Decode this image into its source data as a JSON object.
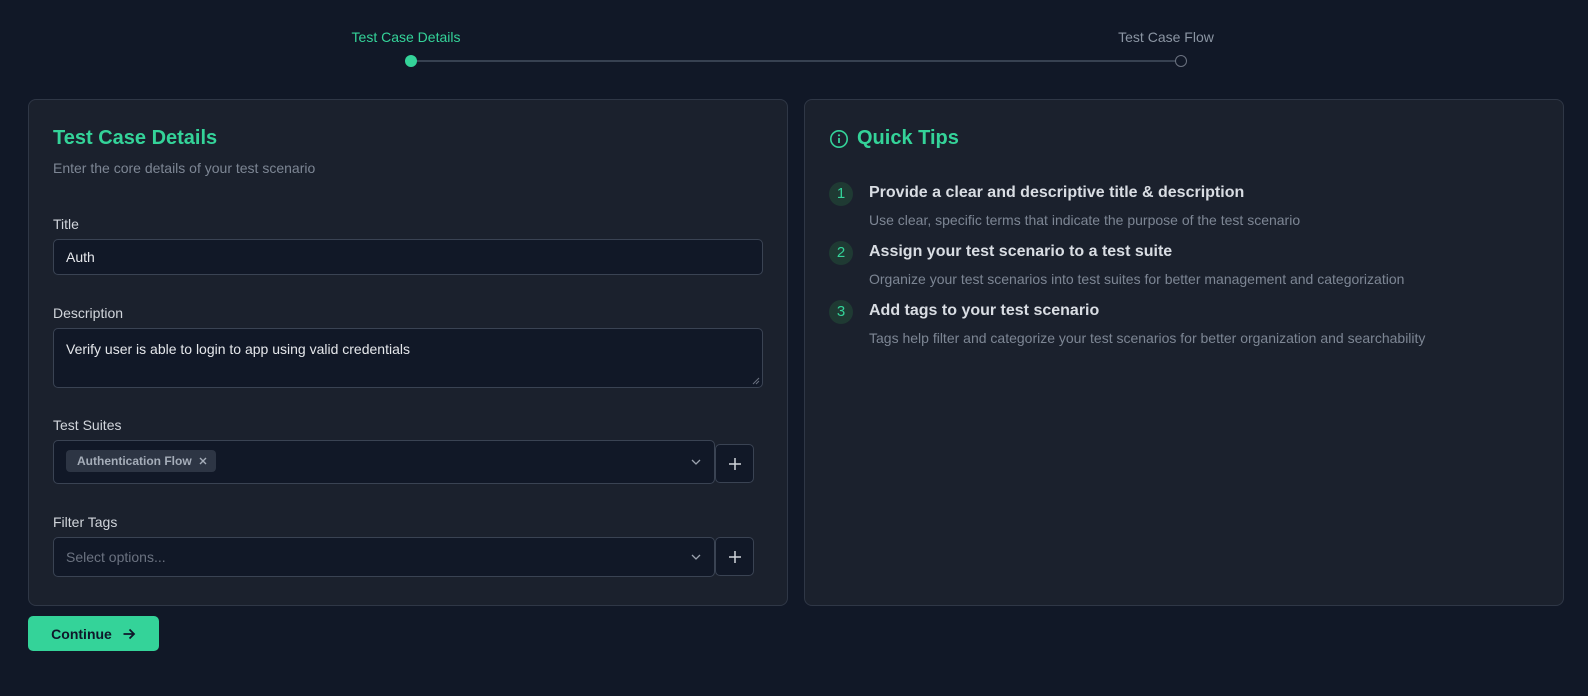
{
  "stepper": {
    "steps": [
      {
        "label": "Test Case Details",
        "state": "active"
      },
      {
        "label": "Test Case Flow",
        "state": "inactive"
      }
    ]
  },
  "details": {
    "title": "Test Case Details",
    "subtitle": "Enter the core details of your test scenario",
    "title_field": {
      "label": "Title",
      "value": "Auth"
    },
    "description_field": {
      "label": "Description",
      "value": "Verify user is able to login to app using valid credentials"
    },
    "test_suites": {
      "label": "Test Suites",
      "selected": [
        "Authentication Flow"
      ],
      "add_icon": "plus-icon"
    },
    "filter_tags": {
      "label": "Filter Tags",
      "placeholder": "Select options...",
      "add_icon": "plus-icon"
    }
  },
  "tips": {
    "title": "Quick Tips",
    "icon": "info-icon",
    "items": [
      {
        "number": "1",
        "title": "Provide a clear and descriptive title & description",
        "description": "Use clear, specific terms that indicate the purpose of the test scenario"
      },
      {
        "number": "2",
        "title": "Assign your test scenario to a test suite",
        "description": "Organize your test scenarios into test suites for better management and categorization"
      },
      {
        "number": "3",
        "title": "Add tags to your test scenario",
        "description": "Tags help filter and categorize your test scenarios for better organization and searchability"
      }
    ]
  },
  "continue_button": {
    "label": "Continue",
    "icon": "arrow-right-icon"
  },
  "colors": {
    "accent": "#34d399",
    "background": "#111827",
    "card": "#1b212d"
  }
}
